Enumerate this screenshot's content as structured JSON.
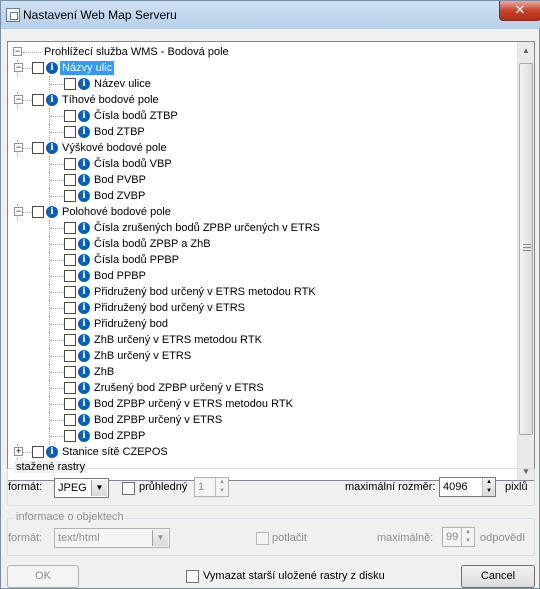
{
  "window": {
    "title": "Nastavení Web Map Serveru",
    "close_glyph": "✕"
  },
  "tree": {
    "root_label": "Prohlížecí služba WMS - Bodová pole",
    "rows": [
      {
        "level": 1,
        "label": "Názvy ulic",
        "expander": "−",
        "selected": true
      },
      {
        "level": 2,
        "label": "Název ulice"
      },
      {
        "level": 1,
        "label": "Tíhové bodové pole",
        "expander": "−"
      },
      {
        "level": 2,
        "label": "Čísla bodů ZTBP"
      },
      {
        "level": 2,
        "label": "Bod ZTBP"
      },
      {
        "level": 1,
        "label": "Výškové bodové pole",
        "expander": "−"
      },
      {
        "level": 2,
        "label": "Čísla bodů VBP"
      },
      {
        "level": 2,
        "label": "Bod PVBP"
      },
      {
        "level": 2,
        "label": "Bod ZVBP"
      },
      {
        "level": 1,
        "label": "Polohové bodové pole",
        "expander": "−"
      },
      {
        "level": 2,
        "label": "Čísla zrušených bodů ZPBP určených v ETRS"
      },
      {
        "level": 2,
        "label": "Čísla bodů ZPBP a ZhB"
      },
      {
        "level": 2,
        "label": "Čísla bodů PPBP"
      },
      {
        "level": 2,
        "label": "Bod PPBP"
      },
      {
        "level": 2,
        "label": "Přidružený bod určený v ETRS metodou RTK"
      },
      {
        "level": 2,
        "label": "Přidružený bod určený v ETRS"
      },
      {
        "level": 2,
        "label": "Přidružený bod"
      },
      {
        "level": 2,
        "label": "ZhB určený v ETRS metodou RTK"
      },
      {
        "level": 2,
        "label": "ZhB určený v ETRS"
      },
      {
        "level": 2,
        "label": "ZhB"
      },
      {
        "level": 2,
        "label": "Zrušený bod ZPBP určený v ETRS"
      },
      {
        "level": 2,
        "label": "Bod ZPBP určený v ETRS metodou RTK"
      },
      {
        "level": 2,
        "label": "Bod ZPBP určený v ETRS"
      },
      {
        "level": 2,
        "label": "Bod ZPBP"
      },
      {
        "level": 1,
        "label": "Stanice sítě CZEPOS",
        "expander": "+"
      }
    ],
    "info_glyph": "i",
    "root_expander": "−"
  },
  "raster": {
    "group_title": "stažené rastry",
    "format_label": "formát:",
    "format_value": "JPEG",
    "transparent_label": "průhledný",
    "transparent_value": "1",
    "max_size_label": "maximální rozměr:",
    "max_size_value": "4096",
    "unit": "pixlů"
  },
  "objects": {
    "group_title": "informace o objektech",
    "format_label": "formát:",
    "format_value": "text/html",
    "suppress_label": "potlačit",
    "max_label": "maximálně:",
    "max_value": "99",
    "unit": "odpovědí"
  },
  "footer": {
    "ok_label": "OK",
    "clear_label": "Vymazat starší uložené rastry z disku",
    "cancel_label": "Cancel"
  },
  "glyphs": {
    "down": "▼",
    "up": "▲"
  }
}
